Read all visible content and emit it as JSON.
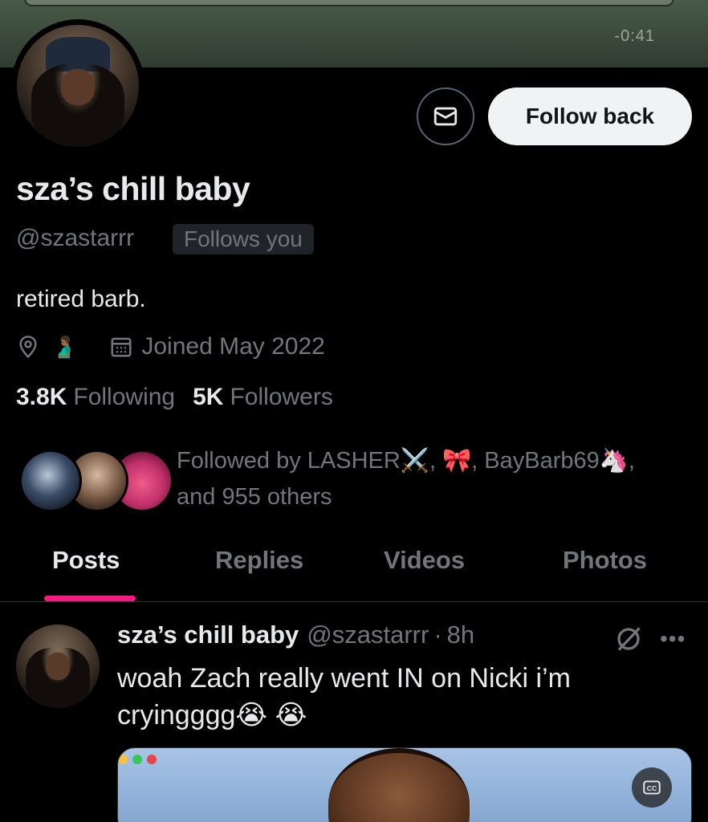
{
  "banner": {
    "video_time": "-0:41"
  },
  "profile": {
    "display_name": "sza’s chill baby",
    "handle": "@szastarrr",
    "follows_you_badge": "Follows you",
    "bio": "retired barb.",
    "location_emoji": "🫃🏾",
    "joined": "Joined May 2022",
    "following_count": "3.8K",
    "following_label": "Following",
    "followers_count": "5K",
    "followers_label": "Followers"
  },
  "actions": {
    "follow_back_label": "Follow back",
    "message_icon": "envelope-icon"
  },
  "followed_by": {
    "line1": "Followed by LASHER⚔️, 🎀, BayBarb69🦄,",
    "line2": "and 955 others"
  },
  "tabs": [
    {
      "label": "Posts",
      "active": true
    },
    {
      "label": "Replies",
      "active": false
    },
    {
      "label": "Videos",
      "active": false
    },
    {
      "label": "Photos",
      "active": false
    }
  ],
  "post": {
    "name": "sza’s chill baby",
    "handle": "@szastarrr",
    "separator": "·",
    "time": "8h",
    "text_line1": "woah Zach really went IN on Nicki i’m",
    "text_line2": "cryingggg😭 😭"
  },
  "colors": {
    "accent": "#f91880",
    "follow_bg": "#eff3f4",
    "muted": "#71767b",
    "text": "#e7e9ea"
  }
}
